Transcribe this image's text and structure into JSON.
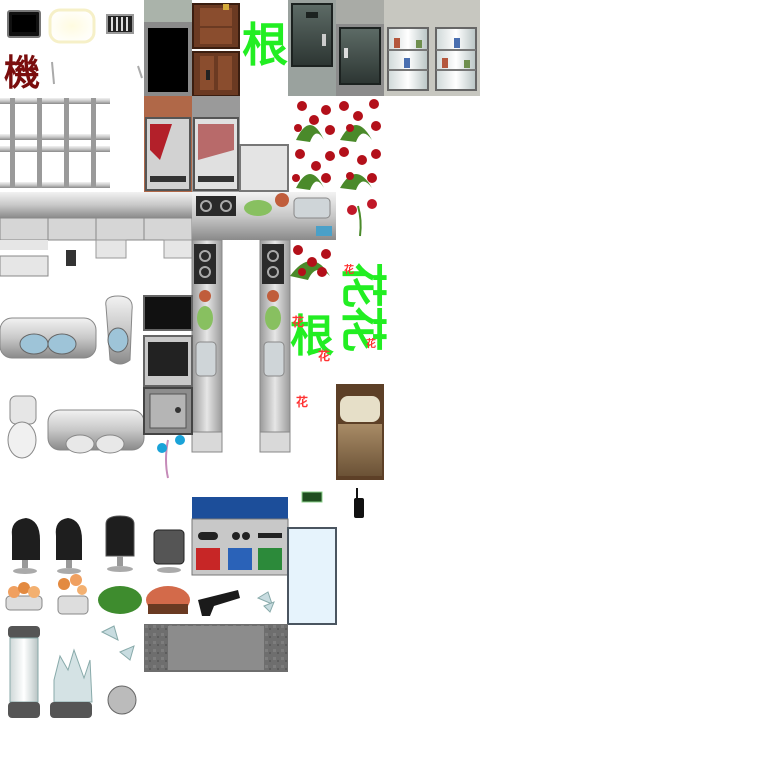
{
  "sheet": {
    "background": "#ffffff",
    "cell_size_label": "48px tiles"
  },
  "glyphs": {
    "machine_kanji": "機",
    "root_kanji": "根",
    "flower_kanji": "花",
    "colors": {
      "dark_red": "#7a0d0d",
      "green": "#22ee22",
      "red": "#ff3333"
    }
  },
  "icons": [
    "monitor-icon",
    "light-panel-icon",
    "vent-grate-icon",
    "dark-doorway-icon",
    "wooden-door-icon",
    "metal-locker-icon",
    "locker-cabinet-icon",
    "glass-cabinet-icon",
    "metal-rack-icon",
    "vending-machine-icon",
    "refrigerator-icon",
    "steel-counter-icon",
    "gas-stove-icon",
    "sink-icon",
    "rose-bush-icon",
    "single-rose-icon",
    "toilet-icon",
    "urinal-bowl-icon",
    "tv-screen-icon",
    "microwave-icon",
    "safe-icon",
    "kitchen-column-icon",
    "bed-icon",
    "office-chair-icon",
    "trash-bin-icon",
    "recycle-station-icon",
    "flower-pot-icon",
    "handgun-icon",
    "glass-shard-icon",
    "glass-capsule-icon",
    "broken-capsule-icon",
    "stone-floor-icon",
    "window-pane-icon",
    "keycard-icon",
    "radio-icon",
    "blue-flower-icon"
  ]
}
